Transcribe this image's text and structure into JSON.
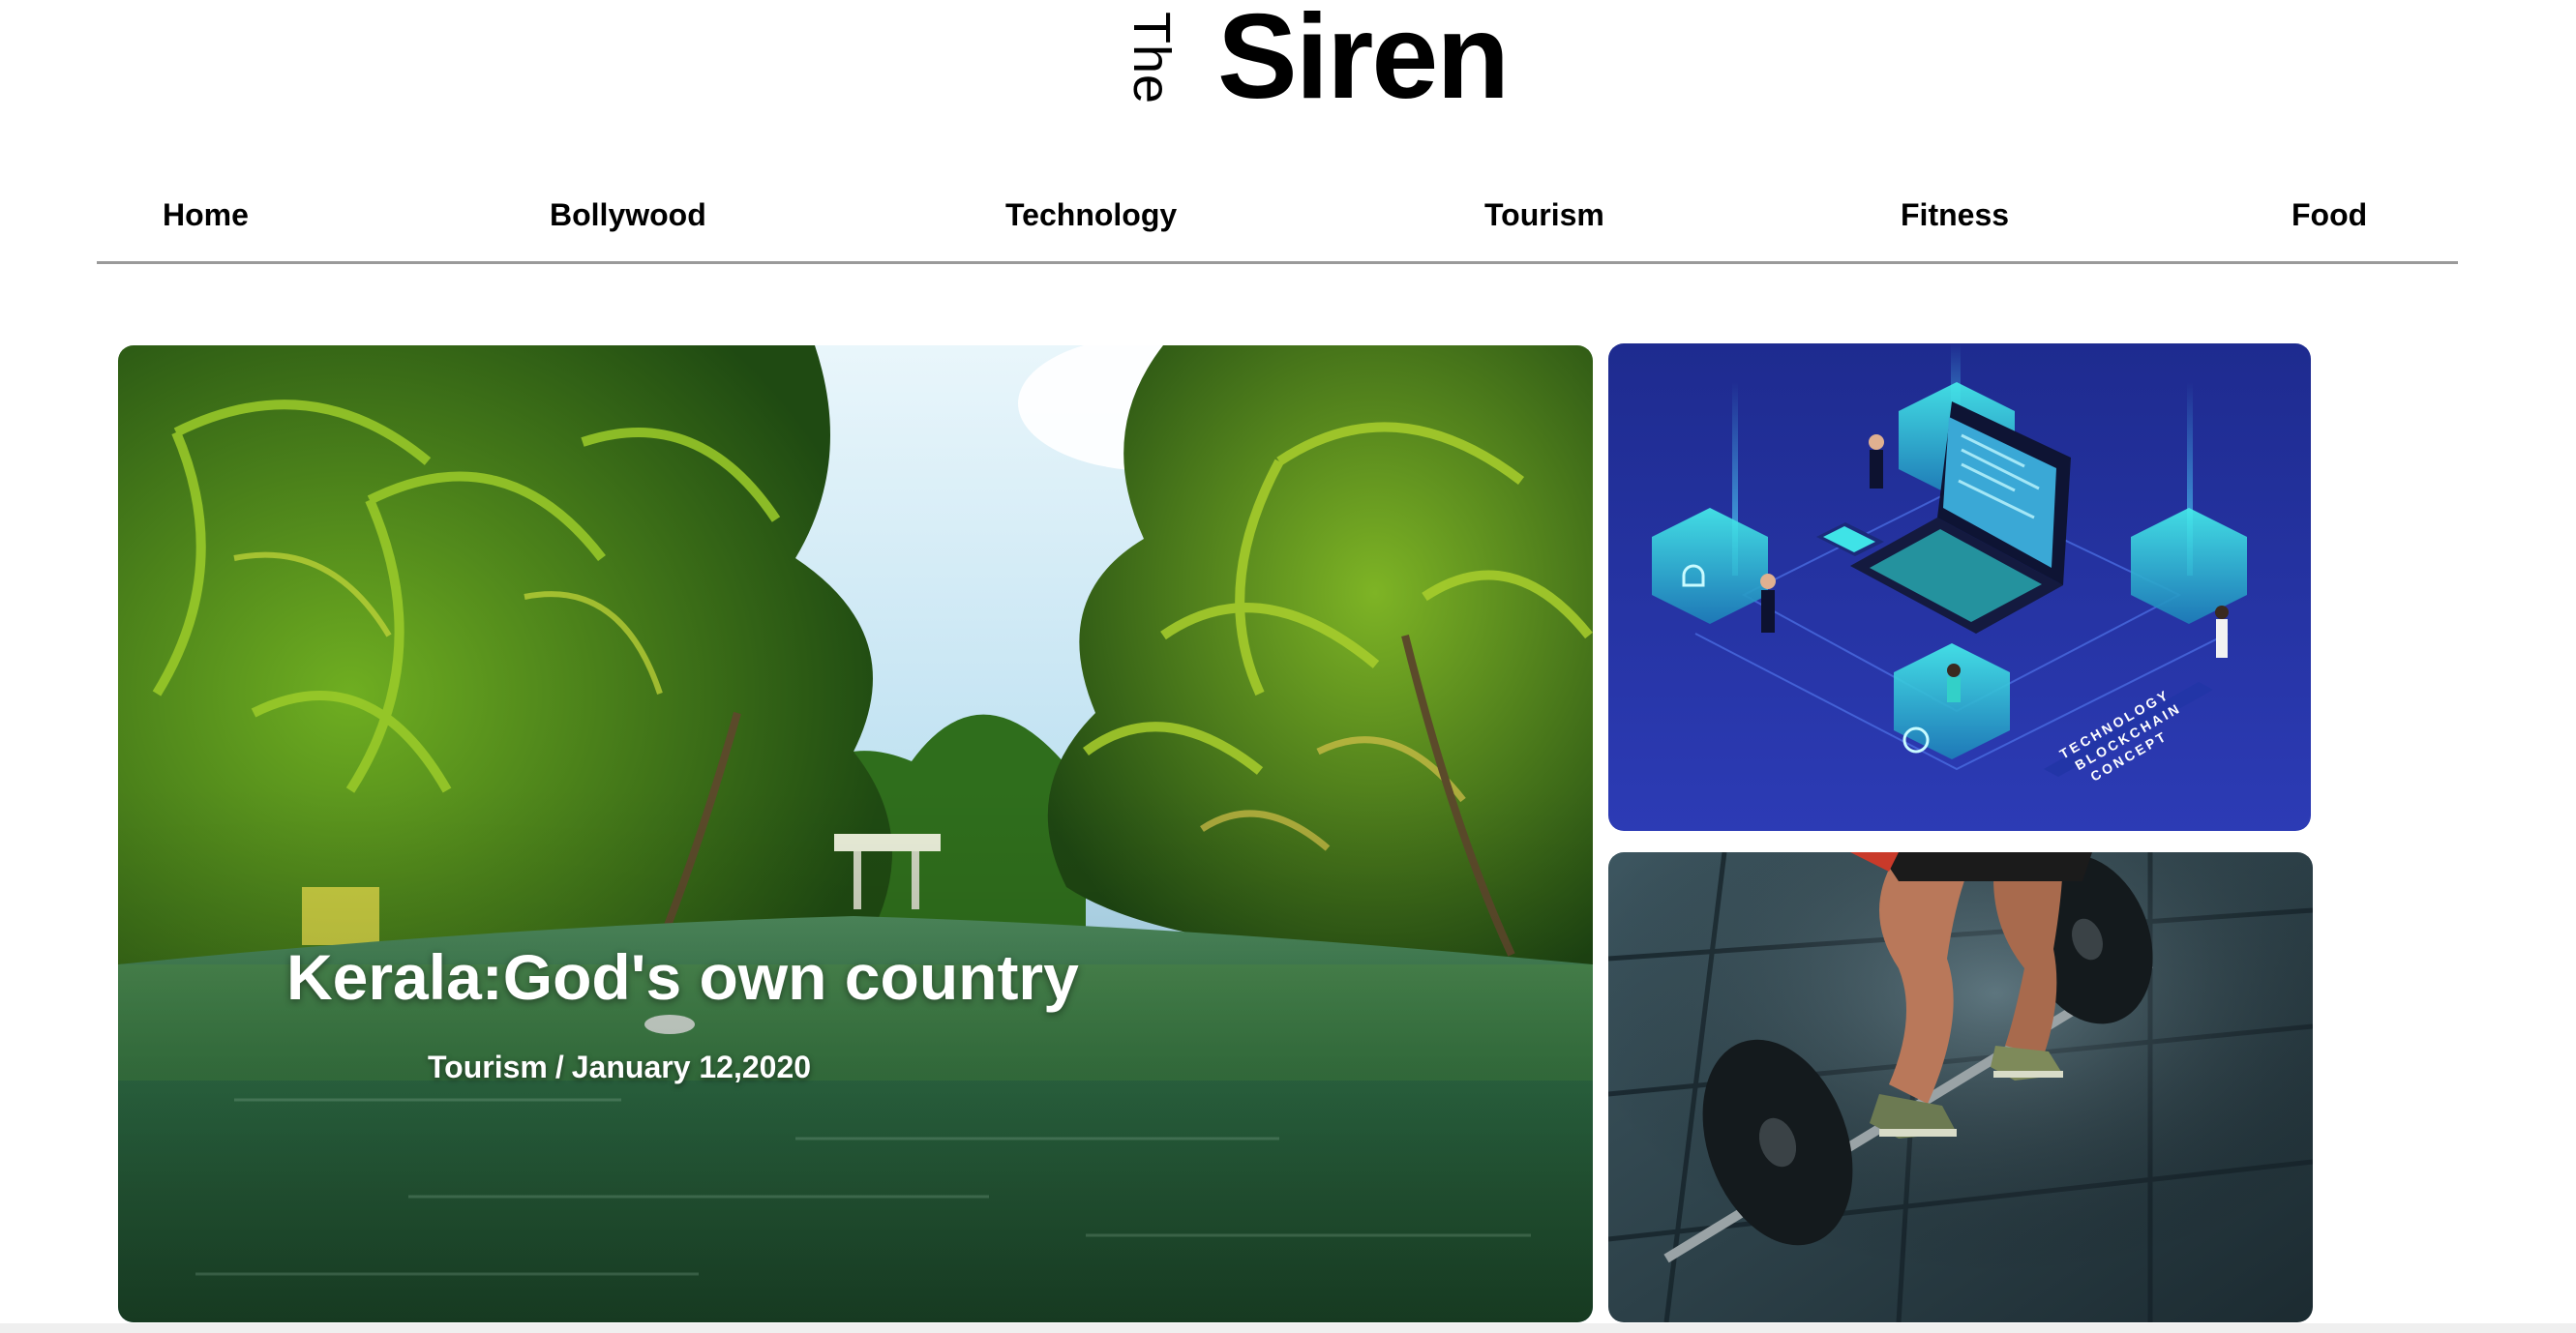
{
  "logo": {
    "the": "The",
    "name": "Siren"
  },
  "nav": {
    "items": [
      {
        "label": "Home"
      },
      {
        "label": "Bollywood"
      },
      {
        "label": "Technology"
      },
      {
        "label": "Tourism"
      },
      {
        "label": "Fitness"
      },
      {
        "label": "Food"
      }
    ]
  },
  "hero": {
    "title": "Kerala:God's own country",
    "category": "Tourism",
    "separator": "/",
    "date": "January 12,2020",
    "image": "kerala-backwaters-photo"
  },
  "cards": {
    "tech": {
      "image": "blockchain-laptop-illustration",
      "caption_lines": [
        "TECHNOLOGY",
        "BLOCKCHAIN",
        "CONCEPT"
      ]
    },
    "fitness": {
      "image": "barbell-deadlift-photo"
    }
  },
  "colors": {
    "nav_rule": "#9a9a9a",
    "tech_bg": "#1f2f9e",
    "tech_cyan": "#35e6e8"
  }
}
